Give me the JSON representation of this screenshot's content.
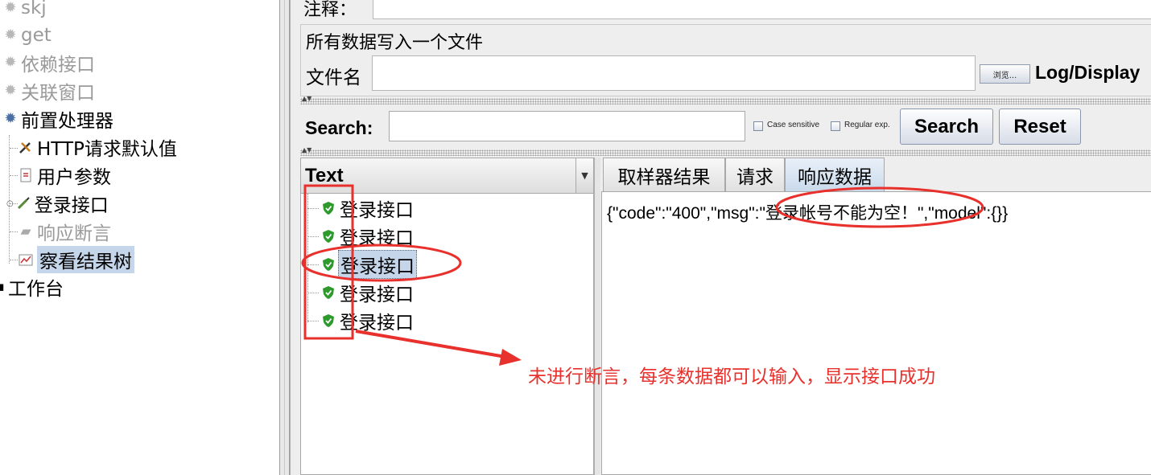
{
  "tree": {
    "items": [
      {
        "label": "skj",
        "state": "disabled",
        "icon": "gear-icon"
      },
      {
        "label": "get",
        "state": "disabled",
        "icon": "gear-icon"
      },
      {
        "label": "依赖接口",
        "state": "disabled",
        "icon": "gear-icon"
      },
      {
        "label": "关联窗口",
        "state": "disabled",
        "icon": "gear-icon"
      },
      {
        "label": "前置处理器",
        "state": "enabled",
        "icon": "gear-icon"
      },
      {
        "label": "HTTP请求默认值",
        "state": "enabled",
        "icon": "wrench-icon"
      },
      {
        "label": "用户参数",
        "state": "enabled",
        "icon": "document-icon"
      },
      {
        "label": "登录接口",
        "state": "enabled",
        "icon": "pen-icon"
      },
      {
        "label": "响应断言",
        "state": "disabled",
        "icon": "assertion-icon"
      },
      {
        "label": "察看结果树",
        "state": "selected",
        "icon": "chart-icon"
      },
      {
        "label": "工作台",
        "state": "enabled",
        "icon": "workbench-icon"
      }
    ]
  },
  "panel": {
    "comment_label": "注释：",
    "file_group_title": "所有数据写入一个文件",
    "file_name_label": "文件名",
    "file_name_value": "",
    "browse_button": "浏览...",
    "log_display_label": "Log/Display",
    "search_label": "Search:",
    "search_value": "",
    "case_sensitive_label": "Case sensitive",
    "regular_exp_label": "Regular exp.",
    "search_button": "Search",
    "reset_button": "Reset"
  },
  "results": {
    "renderer": "Text",
    "items": [
      {
        "label": "登录接口",
        "status": "success"
      },
      {
        "label": "登录接口",
        "status": "success"
      },
      {
        "label": "登录接口",
        "status": "success",
        "selected": true
      },
      {
        "label": "登录接口",
        "status": "success"
      },
      {
        "label": "登录接口",
        "status": "success"
      }
    ]
  },
  "tabs": {
    "items": [
      {
        "label": "取样器结果"
      },
      {
        "label": "请求"
      },
      {
        "label": "响应数据",
        "active": true
      }
    ],
    "response_text": "{\"code\":\"400\",\"msg\":\"登录帐号不能为空！\",\"model\":{}}"
  },
  "annotation": {
    "text": "未进行断言，每条数据都可以输入，显示接口成功",
    "color": "#e8302c"
  },
  "colors": {
    "selection": "#c5d6ea",
    "panel_bg": "#eeeeee",
    "success_green": "#2e9a2e"
  }
}
